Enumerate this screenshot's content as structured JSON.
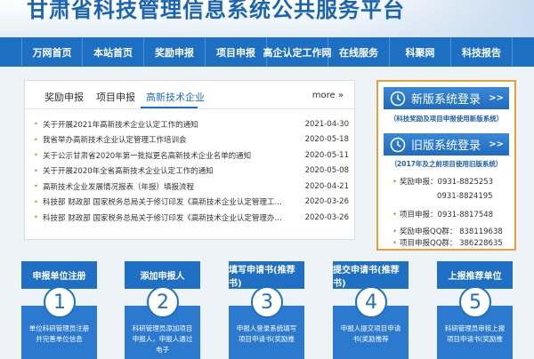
{
  "header": {
    "title": "甘肃省科技管理信息系统公共服务平台"
  },
  "nav": [
    "万网首页",
    "本站首页",
    "奖励申报",
    "项目申报",
    "高企认定工作网",
    "在线服务",
    "科聚网",
    "科技报告"
  ],
  "news": {
    "tabs": [
      "奖励申报",
      "项目申报",
      "高新技术企业"
    ],
    "more": "more »",
    "items": [
      {
        "title": "关于开展2021年高新技术企业认定工作的通知",
        "date": "2021-04-30"
      },
      {
        "title": "我省举办高新技术企业认定管理工作培训会",
        "date": "2020-05-18"
      },
      {
        "title": "关于公示甘肃省2020年第一批拟更名高新技术企业名单的通知",
        "date": "2020-05-11"
      },
      {
        "title": "关于开展2020年全省高新技术企业认定工作的通知",
        "date": "2020-05-08"
      },
      {
        "title": "高新技术企业发展情况报表（年报）填报流程",
        "date": "2020-04-21"
      },
      {
        "title": "科技部 财政部 国家税务总局关于修订印发《高新技术企业认定管理工…",
        "date": "2020-03-26"
      },
      {
        "title": "科技部 财政部 国家税务总局关于修订印发《高新技术企业认定管理办…",
        "date": "2020-03-26"
      }
    ]
  },
  "side": {
    "new_system": {
      "label": "新版系统登录",
      "arrow": ">>",
      "note": "（科技奖励及项目申报使用新版系统）"
    },
    "old_system": {
      "label": "旧版系统登录",
      "arrow": ">>",
      "note": "（2017年及之前项目使用旧版系统）"
    },
    "contacts": [
      {
        "label": "奖励申报：",
        "value": "0931-8825253"
      },
      {
        "label": "",
        "value": "0931-8824195"
      },
      {
        "label": "项目申报：",
        "value": "0931-8817548"
      },
      {
        "label": "奖励申报QQ群：",
        "value": "838119638"
      },
      {
        "label": "项目申报QQ群：",
        "value": "386228635"
      }
    ],
    "accent_color": "#e8a13a"
  },
  "steps": [
    {
      "title": "申报单位注册",
      "num": "1",
      "desc": "单位科研管理员注册并完善单位信息"
    },
    {
      "title": "添加申报人",
      "num": "2",
      "desc": "科研管理员添加项目申报人，申报人通过电子"
    },
    {
      "title": "填写申请书(推荐书)",
      "num": "3",
      "desc": "申报人登录系统填写项目申请书(奖励推"
    },
    {
      "title": "提交申请书(推荐书)",
      "num": "4",
      "desc": "申报人提交项目申请书(奖励推荐"
    },
    {
      "title": "上报推荐单位",
      "num": "5",
      "desc": "科研管理员审核上报项目申请书(奖励推"
    }
  ],
  "colors": {
    "primary": "#1d6fc4",
    "accent": "#e8a13a"
  }
}
